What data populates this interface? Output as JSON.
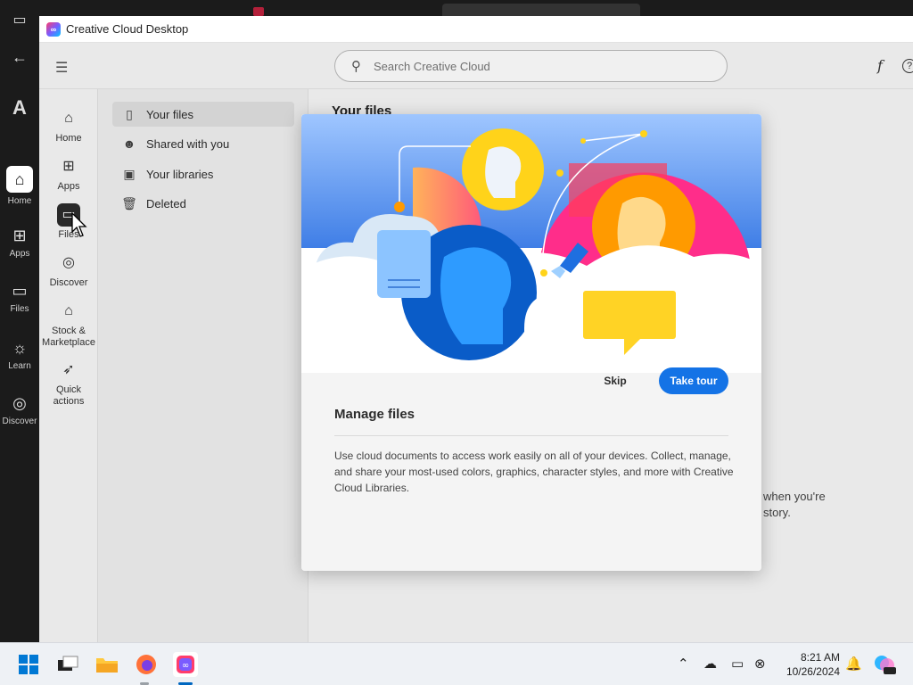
{
  "window": {
    "title": "Creative Cloud Desktop"
  },
  "background_app": {
    "nav": [
      {
        "label": "Home",
        "icon": "home-icon"
      },
      {
        "label": "Apps",
        "icon": "apps-icon"
      },
      {
        "label": "Files",
        "icon": "folder-icon"
      },
      {
        "label": "Learn",
        "icon": "lightbulb-icon"
      },
      {
        "label": "Discover",
        "icon": "compass-icon"
      }
    ]
  },
  "header": {
    "search_placeholder": "Search Creative Cloud",
    "fonts_icon": "f",
    "help_icon": "?"
  },
  "leftnav": {
    "items": [
      {
        "label": "Home",
        "icon": "home-icon"
      },
      {
        "label": "Apps",
        "icon": "apps-icon"
      },
      {
        "label": "Files",
        "icon": "folder-icon",
        "active": true
      },
      {
        "label": "Discover",
        "icon": "compass-icon"
      },
      {
        "label": "Stock & Marketplace",
        "icon": "store-icon"
      },
      {
        "label": "Quick actions",
        "icon": "rocket-icon"
      }
    ]
  },
  "subnav": {
    "items": [
      {
        "label": "Your files",
        "icon": "file-icon",
        "active": true
      },
      {
        "label": "Shared with you",
        "icon": "people-icon"
      },
      {
        "label": "Your libraries",
        "icon": "library-icon"
      },
      {
        "label": "Deleted",
        "icon": "trash-icon"
      }
    ]
  },
  "content": {
    "heading": "Your files",
    "bg_text_line1": "when you're",
    "bg_text_line2": "story."
  },
  "modal": {
    "title": "Manage files",
    "description": "Use cloud documents to access work easily on all of your devices. Collect, manage, and share your most-used colors, graphics, character styles, and more with Creative Cloud Libraries.",
    "skip_label": "Skip",
    "take_tour_label": "Take tour"
  },
  "taskbar": {
    "time": "8:21 AM",
    "date": "10/26/2024"
  },
  "colors": {
    "accent": "#1473e6",
    "cc_pink": "#ff3d6c"
  }
}
